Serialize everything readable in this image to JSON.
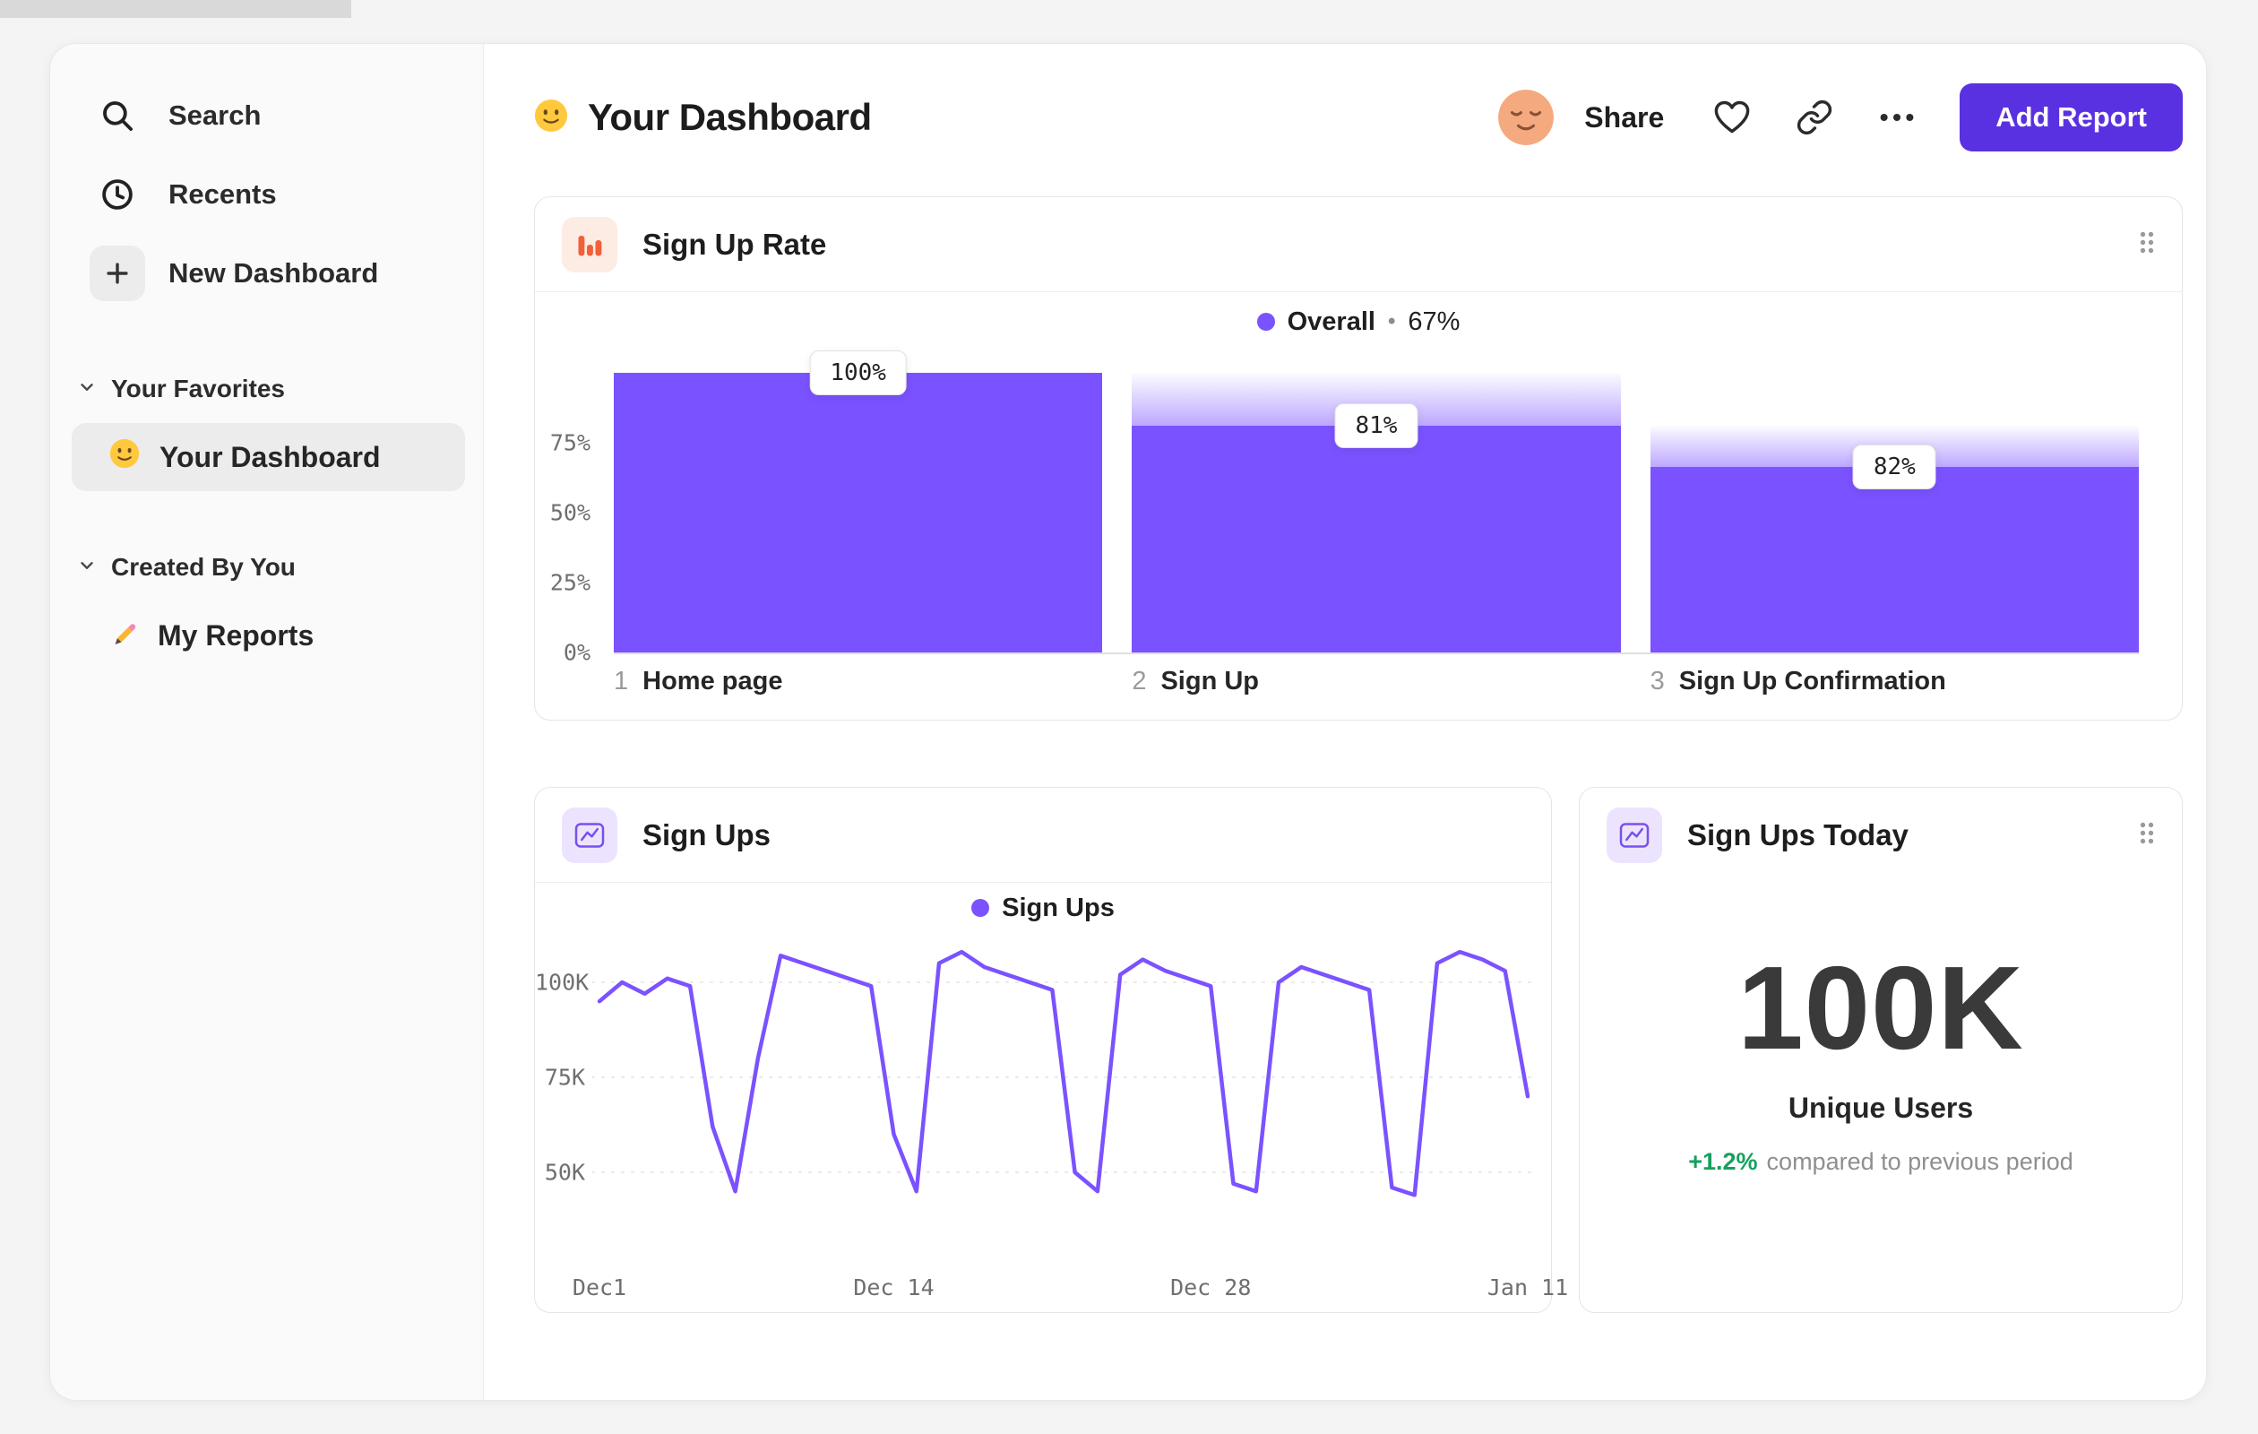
{
  "sidebar": {
    "items": [
      {
        "label": "Search",
        "icon": "search-icon"
      },
      {
        "label": "Recents",
        "icon": "clock-icon"
      },
      {
        "label": "New Dashboard",
        "icon": "plus-icon"
      }
    ],
    "sections": [
      {
        "title": "Your Favorites",
        "items": [
          {
            "label": "Your Dashboard",
            "icon": "smiley-emoji",
            "selected": true
          }
        ]
      },
      {
        "title": "Created By You",
        "items": [
          {
            "label": "My Reports",
            "icon": "pencil-emoji",
            "selected": false
          }
        ]
      }
    ]
  },
  "header": {
    "title": "Your Dashboard",
    "title_icon": "smiley-emoji",
    "avatar": "user-avatar",
    "share_label": "Share",
    "actions": [
      "favorite",
      "copy-link",
      "more"
    ],
    "add_report_label": "Add Report"
  },
  "cards": {
    "sign_up_rate": {
      "title": "Sign Up Rate",
      "legend_label": "Overall",
      "legend_separator": "•",
      "legend_value": "67%"
    },
    "sign_ups": {
      "title": "Sign Ups",
      "legend_label": "Sign Ups"
    },
    "sign_ups_today": {
      "title": "Sign Ups Today",
      "metric_value": "100K",
      "metric_label": "Unique Users",
      "delta": "+1.2%",
      "delta_note": "compared to previous period"
    }
  },
  "colors": {
    "accent_purple": "#7b52ff",
    "button_purple": "#5a31e1",
    "positive_green": "#16a05d",
    "funnel_icon_orange": "#f0603a"
  },
  "chart_data": [
    {
      "type": "bar",
      "subtype": "funnel",
      "title": "Sign Up Rate",
      "legend": [
        {
          "label": "Overall",
          "value": "67%"
        }
      ],
      "step_numbers": [
        "1",
        "2",
        "3"
      ],
      "categories": [
        "Home page",
        "Sign Up",
        "Sign Up Confirmation"
      ],
      "step_conversion_pct": [
        100,
        81,
        82
      ],
      "cumulative_pct": [
        100,
        81,
        66.4
      ],
      "bar_labels": [
        "100%",
        "81%",
        "82%"
      ],
      "y_ticks": [
        75,
        50,
        25,
        0
      ],
      "y_tick_labels": [
        "75%",
        "50%",
        "25%",
        "0%"
      ],
      "ylim": [
        0,
        100
      ],
      "bar_color": "#7b52ff",
      "grid": false
    },
    {
      "type": "line",
      "title": "Sign Ups",
      "series": [
        {
          "name": "Sign Ups",
          "values_thousands": [
            95,
            100,
            97,
            101,
            99,
            62,
            45,
            80,
            107,
            105,
            103,
            101,
            99,
            60,
            45,
            105,
            108,
            104,
            102,
            100,
            98,
            50,
            45,
            102,
            106,
            103,
            101,
            99,
            47,
            45,
            100,
            104,
            102,
            100,
            98,
            46,
            44,
            105,
            108,
            106,
            103,
            70
          ]
        }
      ],
      "x_tick_labels": [
        "Dec1",
        "Dec 14",
        "Dec 28",
        "Jan 11"
      ],
      "x_tick_positions": [
        0,
        13,
        27,
        41
      ],
      "y_ticks": [
        100,
        75,
        50
      ],
      "y_tick_labels": [
        "100K",
        "75K",
        "50K"
      ],
      "ylim_thousands": [
        40,
        112
      ],
      "line_color": "#7b52ff",
      "grid": "dashed-horizontal",
      "legend_position": "top-center"
    }
  ]
}
